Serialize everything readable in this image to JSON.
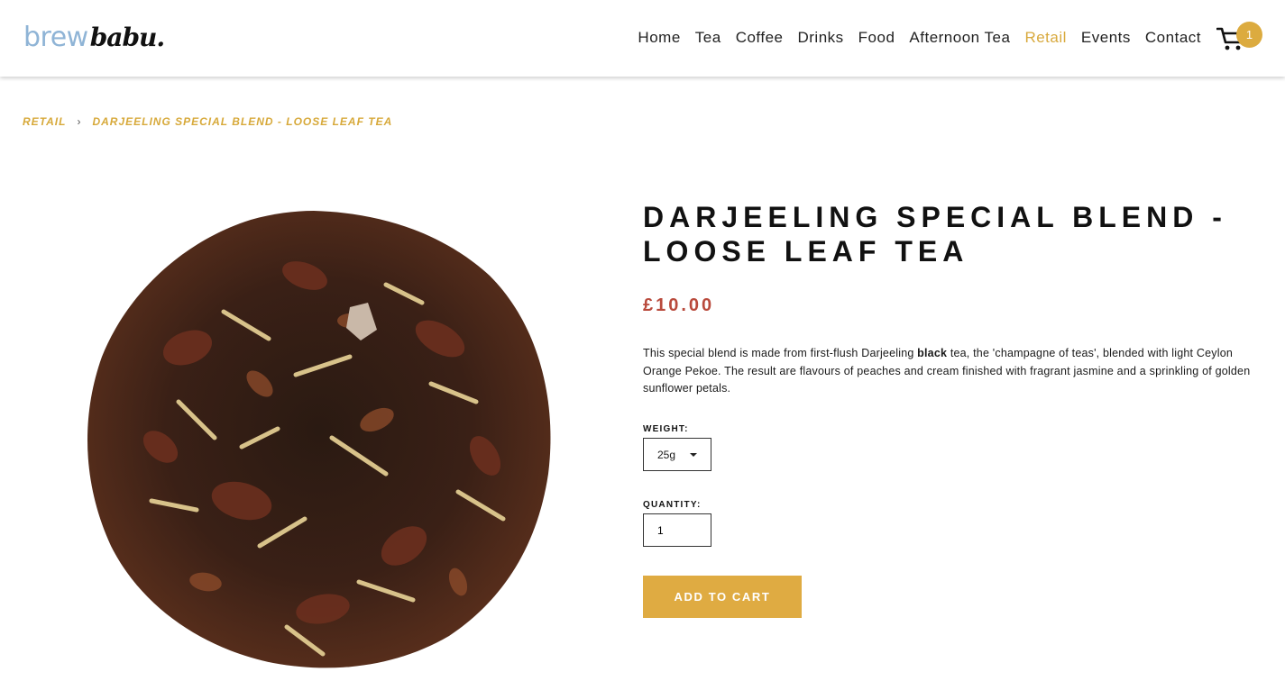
{
  "header": {
    "logo_part1": "brew",
    "logo_part2": "babu.",
    "nav": [
      {
        "label": "Home",
        "active": false
      },
      {
        "label": "Tea",
        "active": false
      },
      {
        "label": "Coffee",
        "active": false
      },
      {
        "label": "Drinks",
        "active": false
      },
      {
        "label": "Food",
        "active": false
      },
      {
        "label": "Afternoon Tea",
        "active": false
      },
      {
        "label": "Retail",
        "active": true
      },
      {
        "label": "Events",
        "active": false
      },
      {
        "label": "Contact",
        "active": false
      }
    ],
    "cart_count": "1"
  },
  "breadcrumb": {
    "parent": "RETAIL",
    "separator": "›",
    "current": "DARJEELING SPECIAL BLEND - LOOSE LEAF TEA"
  },
  "product": {
    "title_line1": "DARJEELING SPECIAL BLEND -",
    "title_line2": "LOOSE LEAF TEA",
    "price": "£10.00",
    "description_pre": "This special blend is made from first-flush Darjeeling ",
    "description_bold": "black",
    "description_post": " tea, the 'champagne of teas', blended with light Ceylon Orange Pekoe. The result are flavours of peaches and cream finished with fragrant jasmine and a sprinkling of golden sunflower petals.",
    "weight_label": "WEIGHT:",
    "weight_value": "25g",
    "quantity_label": "QUANTITY:",
    "quantity_value": "1",
    "add_to_cart_label": "ADD TO CART"
  },
  "colors": {
    "accent": "#d8a93d",
    "price": "#b94a3c",
    "logo_blue": "#8fb4d6"
  }
}
